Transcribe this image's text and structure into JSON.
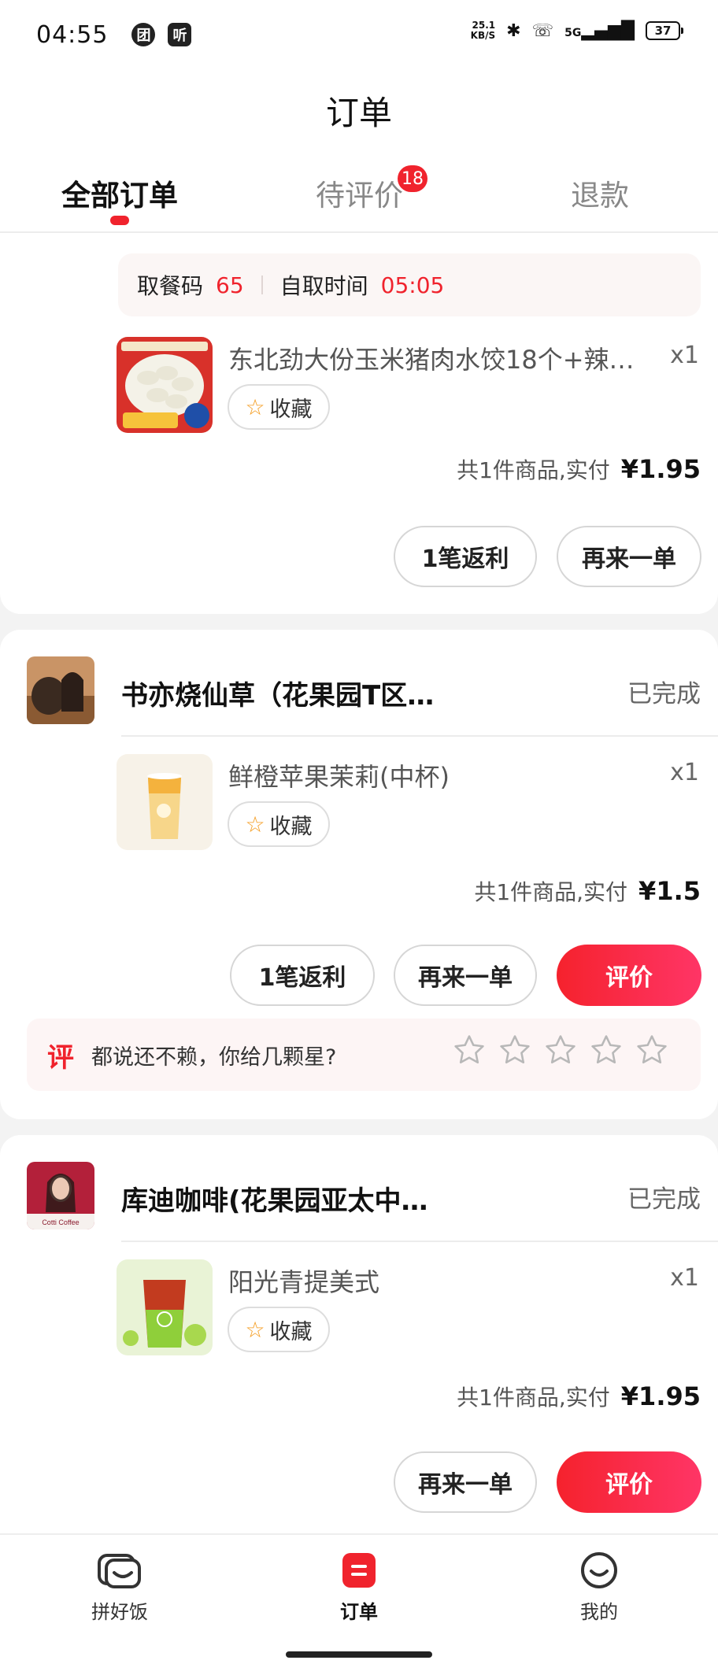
{
  "status_bar": {
    "time": "04:55",
    "app_icons": [
      "团",
      "听"
    ],
    "net_speed_value": "25.1",
    "net_speed_unit": "KB/S",
    "signal": "5G",
    "battery": "37"
  },
  "header": {
    "title": "订单",
    "tabs": [
      {
        "label": "全部订单",
        "active": true
      },
      {
        "label": "待评价",
        "badge": "18"
      },
      {
        "label": "退款"
      }
    ]
  },
  "orders": [
    {
      "pickup": {
        "code_label": "取餐码",
        "code": "65",
        "time_label": "自取时间",
        "time": "05:05"
      },
      "item": {
        "name": "东北劲大份玉米猪肉水饺18个+辣…",
        "qty": "x1",
        "fav_label": "收藏"
      },
      "total": {
        "text": "共1件商品,实付",
        "price": "¥1.95"
      },
      "buttons": {
        "rebate": "1笔返利",
        "reorder": "再来一单"
      }
    },
    {
      "shop": {
        "name": "书亦烧仙草（花果园T区…",
        "status": "已完成"
      },
      "item": {
        "name": "鲜橙苹果茉莉(中杯)",
        "qty": "x1",
        "fav_label": "收藏"
      },
      "total": {
        "text": "共1件商品,实付",
        "price": "¥1.5"
      },
      "buttons": {
        "rebate": "1笔返利",
        "reorder": "再来一单",
        "review": "评价"
      },
      "rate_prompt": {
        "tag": "评",
        "question": "都说还不赖，你给几颗星?",
        "stars": 0
      }
    },
    {
      "shop": {
        "name": "库迪咖啡(花果园亚太中…",
        "status": "已完成",
        "logo_text": "Cotti Coffee"
      },
      "item": {
        "name": "阳光青提美式",
        "qty": "x1",
        "fav_label": "收藏"
      },
      "total": {
        "text": "共1件商品,实付",
        "price": "¥1.95"
      },
      "buttons": {
        "reorder": "再来一单",
        "review": "评价"
      }
    }
  ],
  "bottom_nav": [
    {
      "label": "拼好饭",
      "icon": "pinhaofan-icon"
    },
    {
      "label": "订单",
      "icon": "order-icon",
      "active": true
    },
    {
      "label": "我的",
      "icon": "profile-icon"
    }
  ],
  "colors": {
    "accent": "#f0232d",
    "background": "#f3f3f3"
  }
}
